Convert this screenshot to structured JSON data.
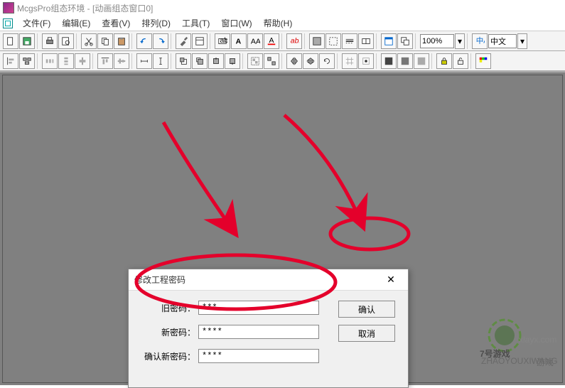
{
  "window": {
    "title": "McgsPro组态环境 - [动画组态窗口0]"
  },
  "menu": {
    "file": "文件(F)",
    "edit": "编辑(E)",
    "view": "查看(V)",
    "arrange": "排列(D)",
    "tools": "工具(T)",
    "window": "窗口(W)",
    "help": "帮助(H)"
  },
  "toolbar": {
    "zoom": "100%",
    "language": "中文"
  },
  "dialog": {
    "title": "修改工程密码",
    "old_password_label": "旧密码：",
    "old_password_value": "***",
    "new_password_label": "新密码：",
    "new_password_value": "****",
    "confirm_password_label": "确认新密码：",
    "confirm_password_value": "****",
    "ok_button": "确认",
    "cancel_button": "取消"
  },
  "watermark": {
    "brand": "7号游戏",
    "sub": "ZHAOYOUXIWANG",
    "url": "xlayx.com"
  }
}
